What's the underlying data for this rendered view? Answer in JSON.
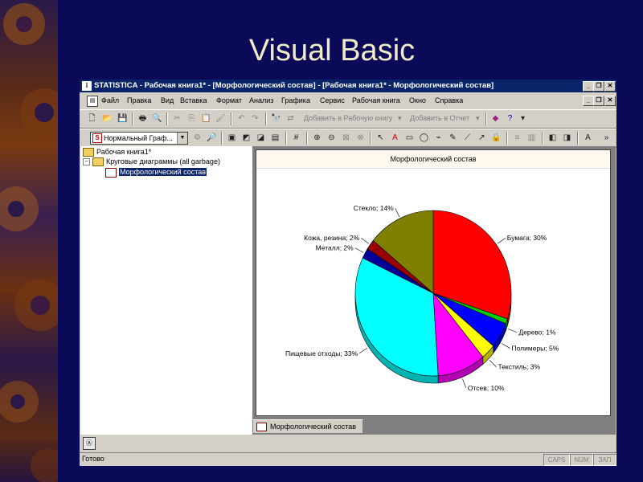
{
  "slide": {
    "title": "Visual Basic"
  },
  "window": {
    "app_icon": "STATISTICA-icon",
    "title": "STATISTICA - Рабочая книга1* - [Морфологический состав] - [Рабочая книга1* - Морфологический состав]",
    "buttons": [
      "minimize-icon",
      "restore-icon",
      "close-icon"
    ]
  },
  "menu": {
    "items": [
      "Файл",
      "Правка",
      "Вид",
      "Вставка",
      "Формат",
      "Анализ",
      "Графика",
      "Сервис",
      "Рабочая книга",
      "Окно",
      "Справка"
    ]
  },
  "toolbar": {
    "add_to_workbook": "Добавить в Рабочую книгу",
    "add_to_report": "Добавить в Отчет",
    "graph_type": "Нормальный Граф..."
  },
  "tree": {
    "root": "Рабочая книга1*",
    "folder": "Круговые диаграммы (all garbage)",
    "selected": "Морфологический состав"
  },
  "chart_tab": {
    "label": "Морфологический состав"
  },
  "status": {
    "text": "Готово",
    "indicators": [
      "CAPS",
      "NUM",
      "ЗАП"
    ]
  },
  "chart_data": {
    "type": "pie",
    "title": "Морфологический состав",
    "slices": [
      {
        "label": "Бумага; 30%",
        "value": 30,
        "color": "#ff0000"
      },
      {
        "label": "Дерево; 1%",
        "value": 1,
        "color": "#00cc00"
      },
      {
        "label": "Полимеры; 5%",
        "value": 5,
        "color": "#0000ff"
      },
      {
        "label": "Текстиль; 3%",
        "value": 3,
        "color": "#ffff00"
      },
      {
        "label": "Отсев; 10%",
        "value": 10,
        "color": "#ff00ff"
      },
      {
        "label": "Пищевые отходы; 33%",
        "value": 33,
        "color": "#00ffff"
      },
      {
        "label": "Металл; 2%",
        "value": 2,
        "color": "#000099"
      },
      {
        "label": "Кожа, резина; 2%",
        "value": 2,
        "color": "#990000"
      },
      {
        "label": "Стекло; 14%",
        "value": 14,
        "color": "#808000"
      }
    ],
    "legend": false,
    "3d": true
  }
}
